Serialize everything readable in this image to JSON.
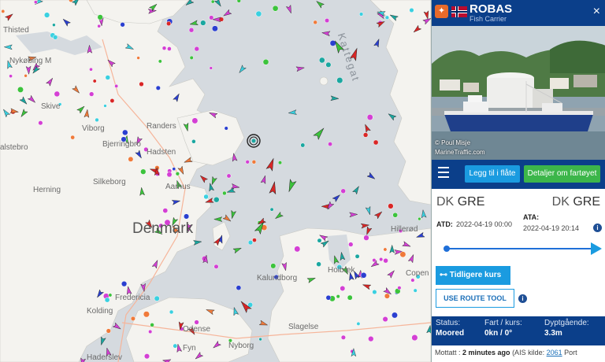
{
  "map": {
    "labels": {
      "thisted": "Thisted",
      "nykobing": "Nykøbing M",
      "skive": "Skive",
      "viborg": "Viborg",
      "randers": "Randers",
      "bjerringbro": "Bjerringbro",
      "hadsten": "Hadsten",
      "silkeborg": "Silkeborg",
      "herning": "Herning",
      "aarhus": "Aarhus",
      "denmark": "Denmark",
      "kattegat": "Kattegat",
      "kalundborg": "Kalundborg",
      "holbaek": "Holbæk",
      "slagelse": "Slagelse",
      "odense": "Odense",
      "fyn": "Fyn",
      "nyborg": "Nyborg",
      "fredericia": "Fredericia",
      "kolding": "Kolding",
      "haderslev": "Haderslev",
      "hillerod": "Hillerød",
      "copenhagen": "Copen",
      "silkeborg_l": "Silkeborg",
      "aalstebro": "alstebro"
    },
    "colors": {
      "sea": "#d5dadf",
      "land": "#f4f3ef",
      "fishing": "#1aa7a0",
      "cargo": "#3cc33c",
      "tanker": "#d92626",
      "passenger": "#2a3fd0",
      "pleasure": "#d43fd4",
      "tug": "#3ad0e0",
      "unknown": "#f07a3a"
    }
  },
  "vessel": {
    "name": "ROBAS",
    "type": "Fish Carrier",
    "close_label": "×",
    "photo_credit": "© Poul Misje",
    "photo_site": "MarineTraffic.com"
  },
  "toolbar": {
    "add_fleet": "Legg til i flåte",
    "details": "Detaljer om fartøyet"
  },
  "voyage": {
    "from_country": "DK",
    "from_port": "GRE",
    "to_country": "DK",
    "to_port": "GRE",
    "atd_label": "ATD:",
    "atd_value": "2022-04-19 00:00",
    "ata_label": "ATA:",
    "ata_value": "2022-04-19 20:14",
    "info_icon": "i",
    "previous_btn": "Tidligere kurs",
    "route_tool_btn": "USE ROUTE TOOL",
    "progress": 1.0
  },
  "status": {
    "status_label": "Status:",
    "status_value": "Moored",
    "speed_label": "Fart / kurs:",
    "speed_value": "0kn / 0°",
    "draught_label": "Dyptgående:",
    "draught_value": "3.3m"
  },
  "received": {
    "prefix": "Mottatt :",
    "time": "2 minutes ago",
    "source_label": "(AIS kilde:",
    "source_id": "2061",
    "tail": "Port"
  }
}
